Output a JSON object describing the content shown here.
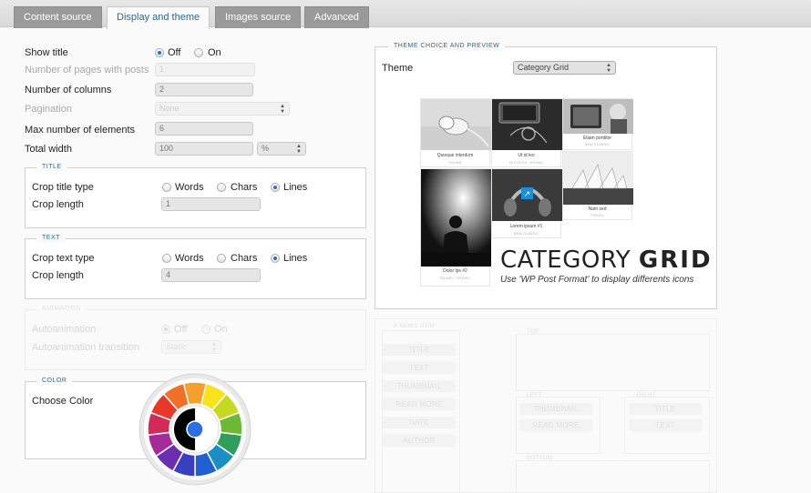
{
  "tabs": [
    {
      "label": "Content source",
      "active": false
    },
    {
      "label": "Display and theme",
      "active": true
    },
    {
      "label": "Images source",
      "active": false
    },
    {
      "label": "Advanced",
      "active": false
    }
  ],
  "general": {
    "show_title": {
      "label": "Show title",
      "options": [
        "Off",
        "On"
      ],
      "selected": "Off"
    },
    "pages_with_posts": {
      "label": "Number of pages with posts",
      "value": "1"
    },
    "columns": {
      "label": "Number of columns",
      "value": "2"
    },
    "pagination": {
      "label": "Pagination",
      "value": "None"
    },
    "max_elements": {
      "label": "Max number of elements",
      "value": "6"
    },
    "total_width": {
      "label": "Total width",
      "value": "100",
      "unit": "%"
    }
  },
  "title_group": {
    "legend": "TITLE",
    "crop_type": {
      "label": "Crop title type",
      "options": [
        "Words",
        "Chars",
        "Lines"
      ],
      "selected": "Lines"
    },
    "crop_length": {
      "label": "Crop length",
      "value": "1"
    }
  },
  "text_group": {
    "legend": "TEXT",
    "crop_type": {
      "label": "Crop text type",
      "options": [
        "Words",
        "Chars",
        "Lines"
      ],
      "selected": "Lines"
    },
    "crop_length": {
      "label": "Crop length",
      "value": "4"
    }
  },
  "animation_group": {
    "legend": "ANIMATION",
    "autoanimation": {
      "label": "Autoanimation",
      "options": [
        "Off",
        "On"
      ],
      "selected": "Off"
    },
    "transition": {
      "label": "Autoanimation transition",
      "value": "Static"
    }
  },
  "color_group": {
    "legend": "COLOR",
    "choose_label": "Choose Color",
    "selected_color": "#2b6fe0"
  },
  "theme_panel": {
    "legend": "THEME CHOICE AND PREVIEW",
    "theme_label": "Theme",
    "theme_value": "Category Grid",
    "preview": {
      "title_light": "CATEGORY",
      "title_bold": "GRID",
      "subtitle": "Use 'WP Post Format' to display differents icons",
      "tiles": [
        {
          "caption": "Quisque interdum",
          "sub": "SOUND"
        },
        {
          "caption": "Ut id leo",
          "sub": "IN FOCUS / SOUND"
        },
        {
          "caption": "Etiam porttitor",
          "sub": "NEW CLASSIC"
        },
        {
          "caption": "Nam sed",
          "sub": "TRAVEL"
        },
        {
          "caption": "Lorem ipsum #1",
          "sub": "NEW CLASSIC"
        },
        {
          "caption": "Dolor lps #2",
          "sub": "SOUND / TRAVEL"
        }
      ]
    }
  },
  "layout_panel": {
    "news_item_label": "A NEWS ITEM",
    "elements": [
      "TITLE",
      "TEXT",
      "THUMBNAIL",
      "READ MORE",
      "DATE",
      "AUTHOR"
    ],
    "top_label": "TOP",
    "left_label": "LEFT",
    "left_items": [
      "THUMBNAIL",
      "READ MORE"
    ],
    "right_label": "RIGHT",
    "right_items": [
      "TITLE",
      "TEXT"
    ],
    "bottom_label": "BOTTOM"
  }
}
